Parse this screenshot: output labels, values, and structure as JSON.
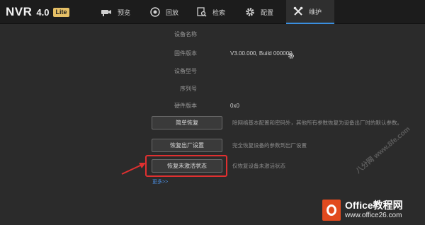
{
  "app": {
    "logo_text": "NVR",
    "version": "4.0",
    "edition_badge": "Lite"
  },
  "nav": {
    "preview": "预览",
    "playback": "回放",
    "search": "检索",
    "config": "配置",
    "maintenance": "维护",
    "active": "maintenance"
  },
  "device_info": {
    "name_label": "设备名称",
    "name_value": "",
    "firmware_label": "固件版本",
    "firmware_value": "V3.00.000, Build 000000",
    "model_label": "设备型号",
    "model_value": "",
    "serial_label": "序列号",
    "serial_value": "",
    "hardware_label": "硬件版本",
    "hardware_value": "0x0"
  },
  "actions": {
    "simple_restore_label": "简单恢复",
    "simple_restore_desc": "除网络基本配置和密码外，其他所有参数恢复为设备出厂时的默认参数。",
    "factory_restore_label": "恢复出厂设置",
    "factory_restore_desc": "完全恢复设备的参数到出厂设置",
    "inactive_restore_label": "恢复未激活状态",
    "inactive_restore_desc": "仅恢复设备未激活状态",
    "more_link": "更多>>"
  },
  "watermark": {
    "diagonal": "八分网 www.8fe.com",
    "brand": "Office教程网",
    "url": "www.office26.com"
  },
  "colors": {
    "accent": "#3a8fe0",
    "highlight": "#e03030",
    "brand_logo": "#e24a1e"
  }
}
